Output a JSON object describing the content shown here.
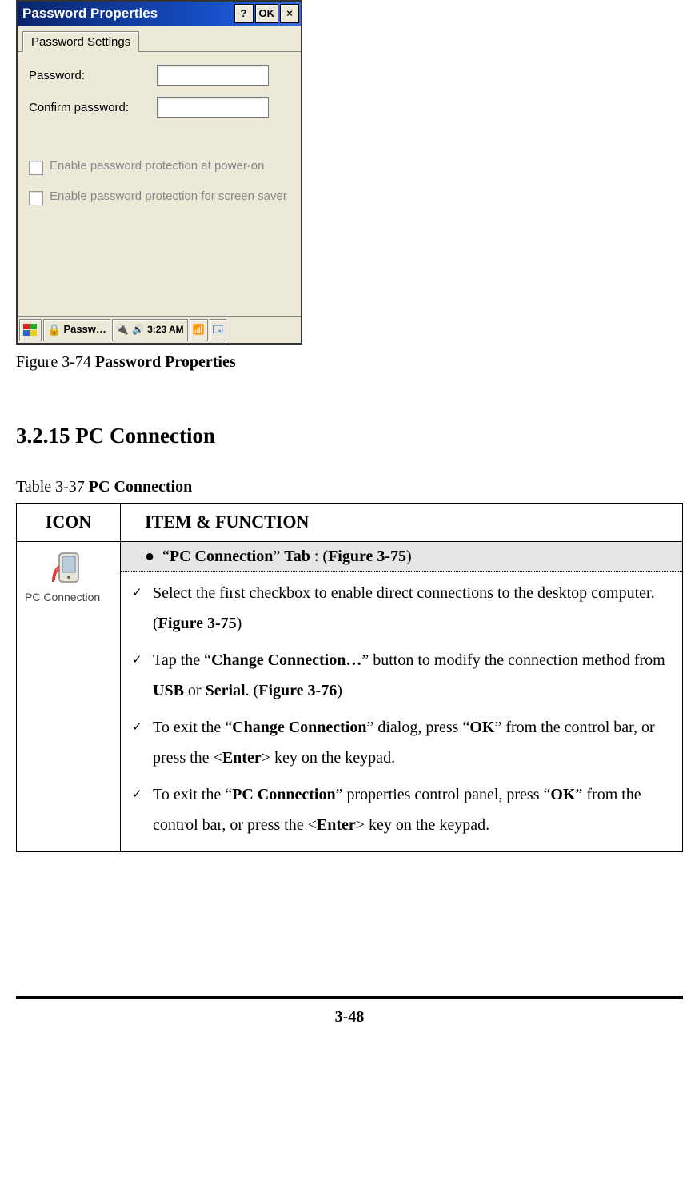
{
  "screenshot": {
    "window_title": "Password Properties",
    "titlebar_buttons": {
      "help": "?",
      "ok": "OK",
      "close": "×"
    },
    "tab_label": "Password Settings",
    "fields": {
      "password_label": "Password:",
      "confirm_label": "Confirm password:"
    },
    "checkboxes": {
      "poweron": "Enable password protection at power-on",
      "screensaver": "Enable password protection for screen saver"
    },
    "taskbar": {
      "app_label": "Passw…",
      "clock": "3:23 AM"
    }
  },
  "figure_caption": {
    "prefix": "Figure 3-74 ",
    "bold": "Password Properties"
  },
  "section_heading": "3.2.15 PC Connection",
  "table_caption": {
    "prefix": "Table 3-37 ",
    "bold": "PC Connection"
  },
  "table": {
    "headers": {
      "icon": "ICON",
      "item": "ITEM & FUNCTION"
    },
    "icon_label": "PC Connection",
    "tab_row": {
      "q1": "“",
      "name": "PC Connection",
      "q2": "” ",
      "tab_word": "Tab",
      "rest": " : (",
      "fig": "Figure 3-75",
      "close": ")"
    },
    "items": [
      {
        "segments": [
          {
            "t": "Select the first checkbox to enable direct connections to the desktop computer. ("
          },
          {
            "t": "Figure 3-75",
            "b": true
          },
          {
            "t": ")"
          }
        ]
      },
      {
        "segments": [
          {
            "t": "Tap the “"
          },
          {
            "t": "Change Connection…",
            "b": true
          },
          {
            "t": "” button to modify the connection method from "
          },
          {
            "t": "USB",
            "b": true
          },
          {
            "t": " or "
          },
          {
            "t": "Serial",
            "b": true
          },
          {
            "t": ". ("
          },
          {
            "t": "Figure 3-76",
            "b": true
          },
          {
            "t": ")"
          }
        ]
      },
      {
        "segments": [
          {
            "t": "To exit the “"
          },
          {
            "t": "Change Connection",
            "b": true
          },
          {
            "t": "” dialog, press “"
          },
          {
            "t": "OK",
            "b": true
          },
          {
            "t": "” from the control bar, or press the <"
          },
          {
            "t": "Enter",
            "b": true
          },
          {
            "t": "> key on the keypad."
          }
        ]
      },
      {
        "segments": [
          {
            "t": "To exit the “"
          },
          {
            "t": "PC Connection",
            "b": true
          },
          {
            "t": "” properties control panel, press “"
          },
          {
            "t": "OK",
            "b": true
          },
          {
            "t": "” from the control bar, or press the <"
          },
          {
            "t": "Enter",
            "b": true
          },
          {
            "t": "> key on the keypad."
          }
        ]
      }
    ]
  },
  "page_number": "3-48"
}
